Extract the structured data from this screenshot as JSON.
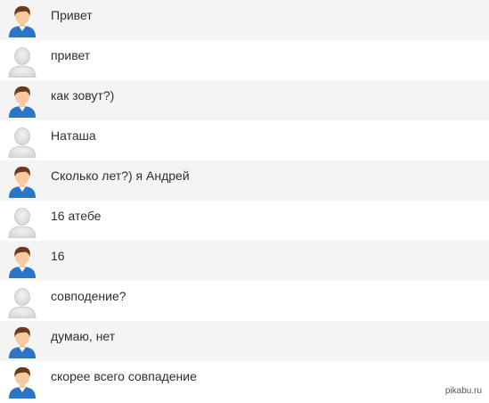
{
  "messages": [
    {
      "sender": "male",
      "text": "Привет"
    },
    {
      "sender": "neutral",
      "text": "привет"
    },
    {
      "sender": "male",
      "text": "как зовут?)"
    },
    {
      "sender": "neutral",
      "text": "Наташа"
    },
    {
      "sender": "male",
      "text": "Сколько лет?) я Андрей"
    },
    {
      "sender": "neutral",
      "text": "16 атебе"
    },
    {
      "sender": "male",
      "text": "16"
    },
    {
      "sender": "neutral",
      "text": "совподение?"
    },
    {
      "sender": "male",
      "text": "думаю, нет"
    },
    {
      "sender": "male",
      "text": "скорее всего совпадение"
    }
  ],
  "icons": {
    "male": "male-user-avatar-icon",
    "neutral": "default-user-avatar-icon"
  },
  "colors": {
    "row_odd": "#f4f4f4",
    "row_even": "#ffffff",
    "shirt_blue": "#2b74c8",
    "hair_brown": "#6b3a1c",
    "skin": "#f6c9a0",
    "neutral_gray": "#d6d6d6"
  },
  "watermark": "pikabu.ru"
}
